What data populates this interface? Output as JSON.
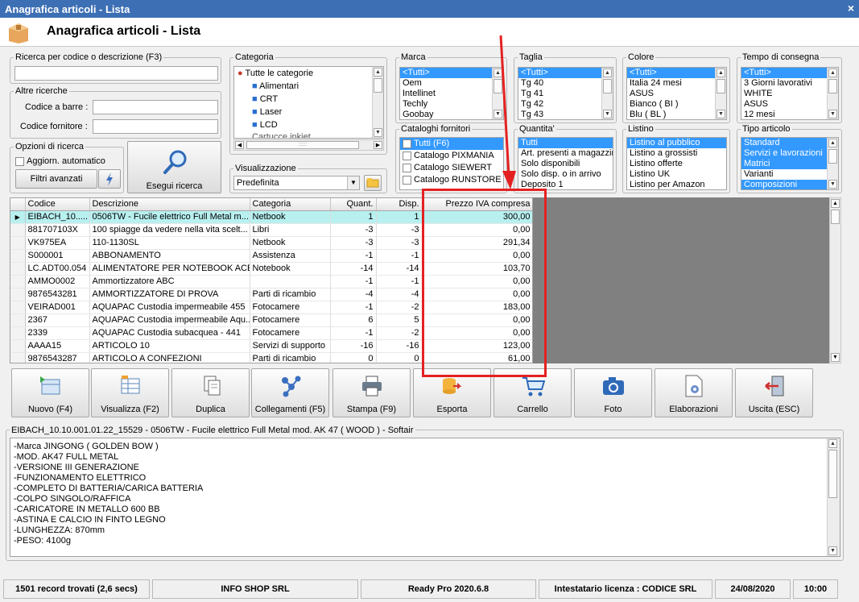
{
  "window": {
    "title": "Anagrafica articoli  - Lista",
    "close": "×"
  },
  "header": {
    "title": "Anagrafica articoli  - Lista"
  },
  "search": {
    "legend": "Ricerca per codice o descrizione (F3)",
    "value": ""
  },
  "other": {
    "legend": "Altre ricerche",
    "barcode_label": "Codice a barre :",
    "supplier_label": "Codice fornitore :"
  },
  "options": {
    "legend": "Opzioni di ricerca",
    "auto_update": "Aggiorn. automatico",
    "advanced_filters": "Filtri avanzati"
  },
  "search_button": "Esegui ricerca",
  "categoria": {
    "legend": "Categoria",
    "root": "Tutte le categorie",
    "items": [
      "Alimentari",
      "CRT",
      "Laser",
      "LCD",
      "Cartucce inkjet"
    ],
    "scroll_grip": "::::::"
  },
  "visualizzazione": {
    "legend": "Visualizzazione",
    "value": "Predefinita"
  },
  "marca": {
    "legend": "Marca",
    "items": [
      "<Tutti>",
      "Oem",
      "Intellinet",
      "Techly",
      "Goobay"
    ]
  },
  "taglia": {
    "legend": "Taglia",
    "items": [
      "<Tutti>",
      "Tg 40",
      "Tg 41",
      "Tg 42",
      "Tg 43"
    ]
  },
  "colore": {
    "legend": "Colore",
    "items": [
      "<Tutti>",
      "Italia 24 mesi",
      "ASUS",
      "Bianco ( BI )",
      "Blu ( BL )"
    ]
  },
  "tempo": {
    "legend": "Tempo di consegna",
    "items": [
      "<Tutti>",
      "3 Giorni lavorativi",
      "WHITE",
      "ASUS",
      "12 mesi"
    ]
  },
  "cataloghi": {
    "legend": "Cataloghi fornitori",
    "items": [
      "Tutti (F6)",
      "Catalogo PIXMANIA",
      "Catalogo SIEWERT",
      "Catalogo RUNSTORE"
    ]
  },
  "quantita": {
    "legend": "Quantita'",
    "items": [
      "Tutti",
      "Art. presenti a magazzino",
      "Solo disponibili",
      "Solo disp. o in arrivo",
      "Deposito 1"
    ]
  },
  "listino": {
    "legend": "Listino",
    "items": [
      "Listino al pubblico",
      "Listino a grossisti",
      "Listino offerte",
      "Listino UK",
      "Listino per Amazon"
    ]
  },
  "tipo": {
    "legend": "Tipo articolo",
    "items": [
      "Standard",
      "Servizi e lavorazioni",
      "Matrici",
      "Varianti",
      "Composizioni"
    ]
  },
  "grid": {
    "columns": [
      "Codice",
      "Descrizione",
      "Categoria",
      "Quant.",
      "Disp.",
      "Prezzo IVA compresa"
    ],
    "rows": [
      [
        "EIBACH_10.....",
        "0506TW  - Fucile elettrico Full Metal m...",
        "Netbook",
        "1",
        "1",
        "300,00"
      ],
      [
        "881707103X",
        "100 spiagge da vedere nella vita scelt...",
        "Libri",
        "-3",
        "-3",
        "0,00"
      ],
      [
        "VK975EA",
        "110-1130SL",
        "Netbook",
        "-3",
        "-3",
        "291,34"
      ],
      [
        "S000001",
        "ABBONAMENTO",
        "Assistenza",
        "-1",
        "-1",
        "0,00"
      ],
      [
        "LC.ADT00.054",
        "ALIMENTATORE PER NOTEBOOK ACER",
        "Notebook",
        "-14",
        "-14",
        "103,70"
      ],
      [
        "AMMO0002",
        "Ammortizzatore ABC",
        "",
        "-1",
        "-1",
        "0,00"
      ],
      [
        "9876543281",
        "AMMORTIZZATORE DI PROVA",
        "Parti di ricambio",
        "-4",
        "-4",
        "0,00"
      ],
      [
        "VEIRAD001",
        "AQUAPAC Custodia impermeabile 455",
        "Fotocamere",
        "-1",
        "-2",
        "183,00"
      ],
      [
        "2367",
        "AQUAPAC Custodia impermeabile Aqu...",
        "Fotocamere",
        "6",
        "5",
        "0,00"
      ],
      [
        "2339",
        "AQUAPAC Custodia subacquea - 441",
        "Fotocamere",
        "-1",
        "-2",
        "0,00"
      ],
      [
        "AAAA15",
        "ARTICOLO 10",
        "Servizi di supporto",
        "-16",
        "-16",
        "123,00"
      ],
      [
        "9876543287",
        "ARTICOLO A CONFEZIONI",
        "Parti di ricambio",
        "0",
        "0",
        "61,00"
      ]
    ]
  },
  "toolbar": [
    "Nuovo (F4)",
    "Visualizza (F2)",
    "Duplica",
    "Collegamenti (F5)",
    "Stampa (F9)",
    "Esporta",
    "Carrello",
    "Foto",
    "Elaborazioni",
    "Uscita (ESC)"
  ],
  "detail": {
    "legend": "EIBACH_10.10.001.01.22_15529 - 0506TW  - Fucile elettrico Full Metal mod. AK 47 ( WOOD ) - Softair",
    "lines": [
      "-Marca JINGONG ( GOLDEN BOW )",
      "-MOD. AK47 FULL METAL",
      "-VERSIONE III GENERAZIONE",
      "-FUNZIONAMENTO ELETTRICO",
      "-COMPLETO DI BATTERIA/CARICA BATTERIA",
      "-COLPO SINGOLO/RAFFICA",
      "-CARICATORE IN METALLO 600 BB",
      "-ASTINA E CALCIO IN FINTO LEGNO",
      "-LUNGHEZZA: 870mm",
      "-PESO: 4100g"
    ]
  },
  "status": {
    "records": "1501 record trovati (2,6 secs)",
    "company": "INFO SHOP SRL",
    "version": "Ready Pro 2020.6.8",
    "license": "Intestatario licenza : CODICE SRL",
    "date": "24/08/2020",
    "time": "10:00"
  },
  "colors": {
    "title_bar": "#3d6fb4",
    "selection": "#3399ff",
    "row_highlight": "#b8f0f0",
    "annotation": "#e42121"
  }
}
